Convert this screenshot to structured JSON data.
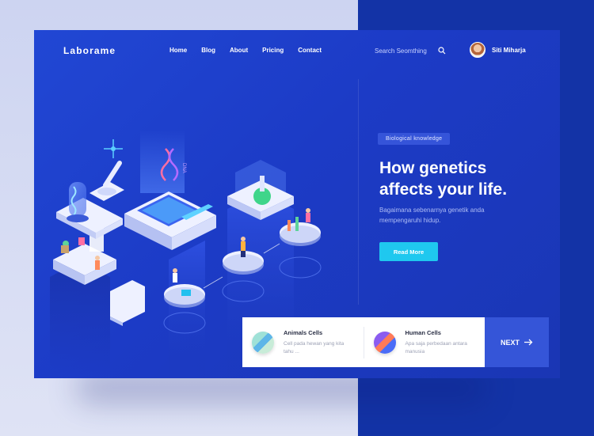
{
  "brand": {
    "logo": "Laborame"
  },
  "nav": {
    "items": [
      "Home",
      "Blog",
      "About",
      "Pricing",
      "Contact"
    ]
  },
  "search": {
    "placeholder": "Search Seomthing"
  },
  "user": {
    "name": "Siti Miharja"
  },
  "hero": {
    "badge": "Biological knowledge",
    "title_line1": "How genetics",
    "title_line2": "affects your life.",
    "subtitle": "Bagaimana sebenarnya genetik anda mempengaruhi hidup.",
    "cta": "Read More"
  },
  "cells": [
    {
      "title": "Animals Cells",
      "desc": "Cell pada hewan yang kita tahu ..."
    },
    {
      "title": "Human Cells",
      "desc": "Apa saja perbedaan antara manusia"
    }
  ],
  "next": {
    "label": "NEXT"
  },
  "illustration": {
    "dna_label": "DNA"
  },
  "colors": {
    "card": "#1f42cf",
    "accent": "#1fc8ef",
    "next": "#3555d8"
  }
}
